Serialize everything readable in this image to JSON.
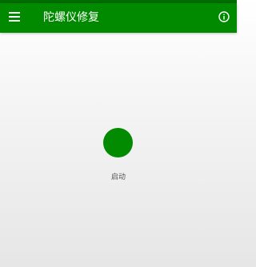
{
  "app_bar": {
    "title": "陀螺仪修复",
    "menu_icon": "hamburger-menu-icon",
    "info_icon": "info-icon"
  },
  "main": {
    "start_label": "启动"
  },
  "colors": {
    "status_bar": "#006c00",
    "primary": "#018a00",
    "button": "#028a00",
    "on_primary": "#ffffff",
    "label_text": "#555555"
  }
}
